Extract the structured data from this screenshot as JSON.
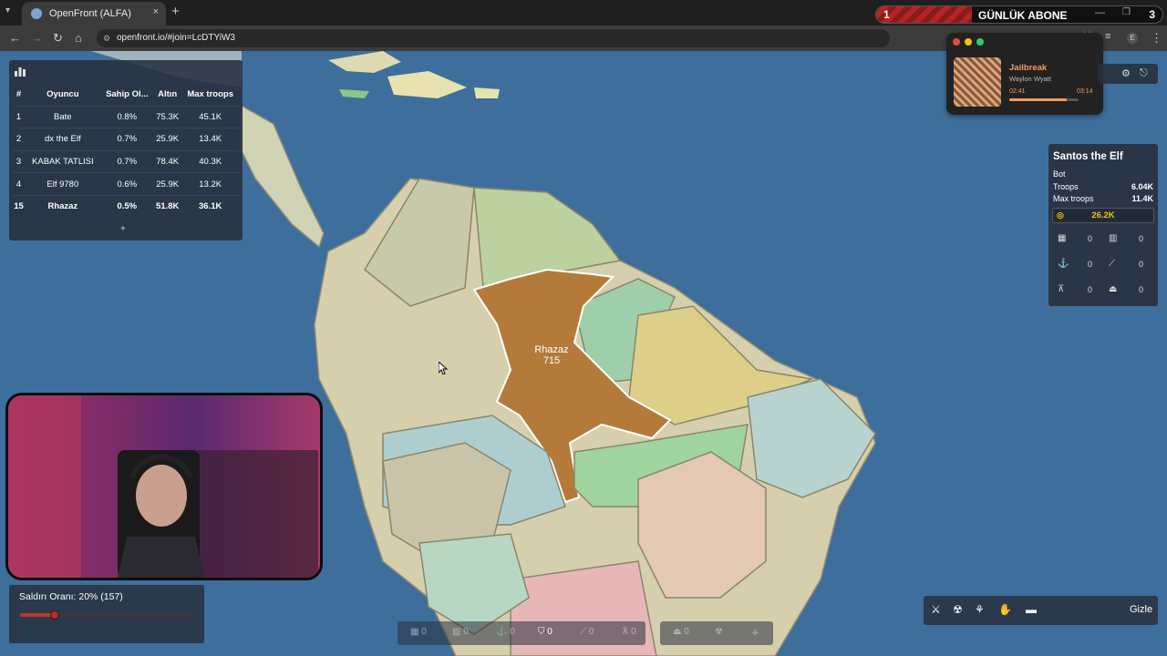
{
  "browser": {
    "tab_title": "OpenFront (ALFA)",
    "tab_close": "×",
    "new_tab": "+",
    "url": "openfront.io/#join=LcDTYiW3",
    "banner": {
      "left_num": "1",
      "title": "GÜNLÜK ABONE",
      "right_num": "3"
    }
  },
  "leaderboard": {
    "headers": [
      "#",
      "Oyuncu",
      "Sahip Ol...",
      "Altın",
      "Max troops"
    ],
    "rows": [
      [
        "1",
        "Bate",
        "0.8%",
        "75.3K",
        "45.1K"
      ],
      [
        "2",
        "dx the Elf",
        "0.7%",
        "25.9K",
        "13.4K"
      ],
      [
        "3",
        "KABAK TATLISI",
        "0.7%",
        "78.4K",
        "40.3K"
      ],
      [
        "4",
        "Elf 9780",
        "0.6%",
        "25.9K",
        "13.2K"
      ],
      [
        "15",
        "Rhazaz",
        "0.5%",
        "51.8K",
        "36.1K"
      ]
    ],
    "expand": "+"
  },
  "map": {
    "labels": [
      {
        "name": "Rhazaz",
        "troops": "715"
      }
    ]
  },
  "attack": {
    "label": "Saldırı Oranı: 20% (157)",
    "ratio_percent": 20
  },
  "music": {
    "song": "Jailbreak",
    "artist": "Waylon Wyatt",
    "current": "02:41",
    "total": "03:14",
    "progress": 0.83
  },
  "player_info": {
    "name": "Santos the Elf",
    "type": "Bot",
    "troops_label": "Troops",
    "troops": "6.04K",
    "max_troops_label": "Max troops",
    "max_troops": "11.4K",
    "gold": "26.2K",
    "buildings": [
      {
        "icon": "city-icon",
        "count": "0"
      },
      {
        "icon": "factory-icon",
        "count": "0"
      },
      {
        "icon": "port-icon",
        "count": "0"
      },
      {
        "icon": "missile-silo-icon",
        "count": "0"
      },
      {
        "icon": "defense-post-icon",
        "count": "0"
      },
      {
        "icon": "warship-icon",
        "count": "0"
      }
    ]
  },
  "build_bar": {
    "counts": [
      "0",
      "0",
      "0",
      "0",
      "0",
      "0",
      "0"
    ]
  },
  "actions": {
    "hide_label": "Gizle"
  },
  "colors": {
    "ocean": "#3e6f9c",
    "player_territory": "#b37a3a",
    "accent_gold": "#f1c40f",
    "attack_red": "#c0392b"
  }
}
